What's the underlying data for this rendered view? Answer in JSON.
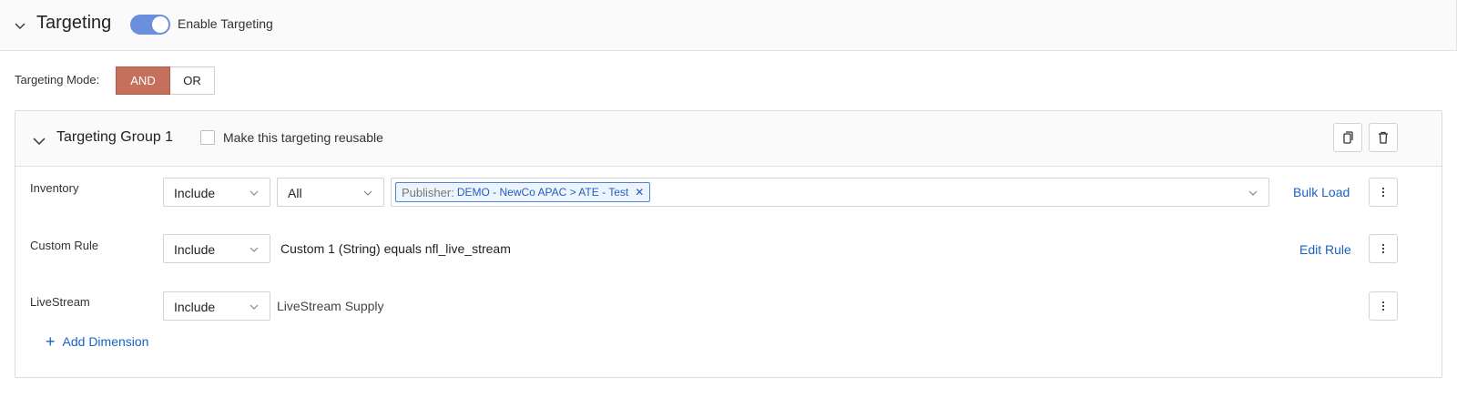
{
  "header": {
    "title": "Targeting",
    "toggle_label": "Enable Targeting",
    "toggle_on": true
  },
  "mode": {
    "label": "Targeting Mode:",
    "options": [
      "AND",
      "OR"
    ],
    "selected": "AND"
  },
  "group": {
    "title": "Targeting Group 1",
    "reusable_label": "Make this targeting reusable",
    "rows": [
      {
        "label": "Inventory",
        "include": "Include",
        "scope": "All",
        "chip_key": "Publisher:",
        "chip_value": "DEMO - NewCo APAC > ATE - Test",
        "action": "Bulk Load"
      },
      {
        "label": "Custom Rule",
        "include": "Include",
        "rule": "Custom 1 (String) equals nfl_live_stream",
        "action": "Edit Rule"
      },
      {
        "label": "LiveStream",
        "include": "Include",
        "text": "LiveStream Supply"
      }
    ],
    "add_dimension": "Add Dimension"
  },
  "colors": {
    "accent_blue": "#1a62c4",
    "toggle_blue": "#6a8fdd",
    "and_active": "#c4705d"
  },
  "icons": [
    "chevron-down-icon",
    "copy-icon",
    "trash-icon",
    "more-vertical-icon",
    "close-icon",
    "plus-icon"
  ]
}
